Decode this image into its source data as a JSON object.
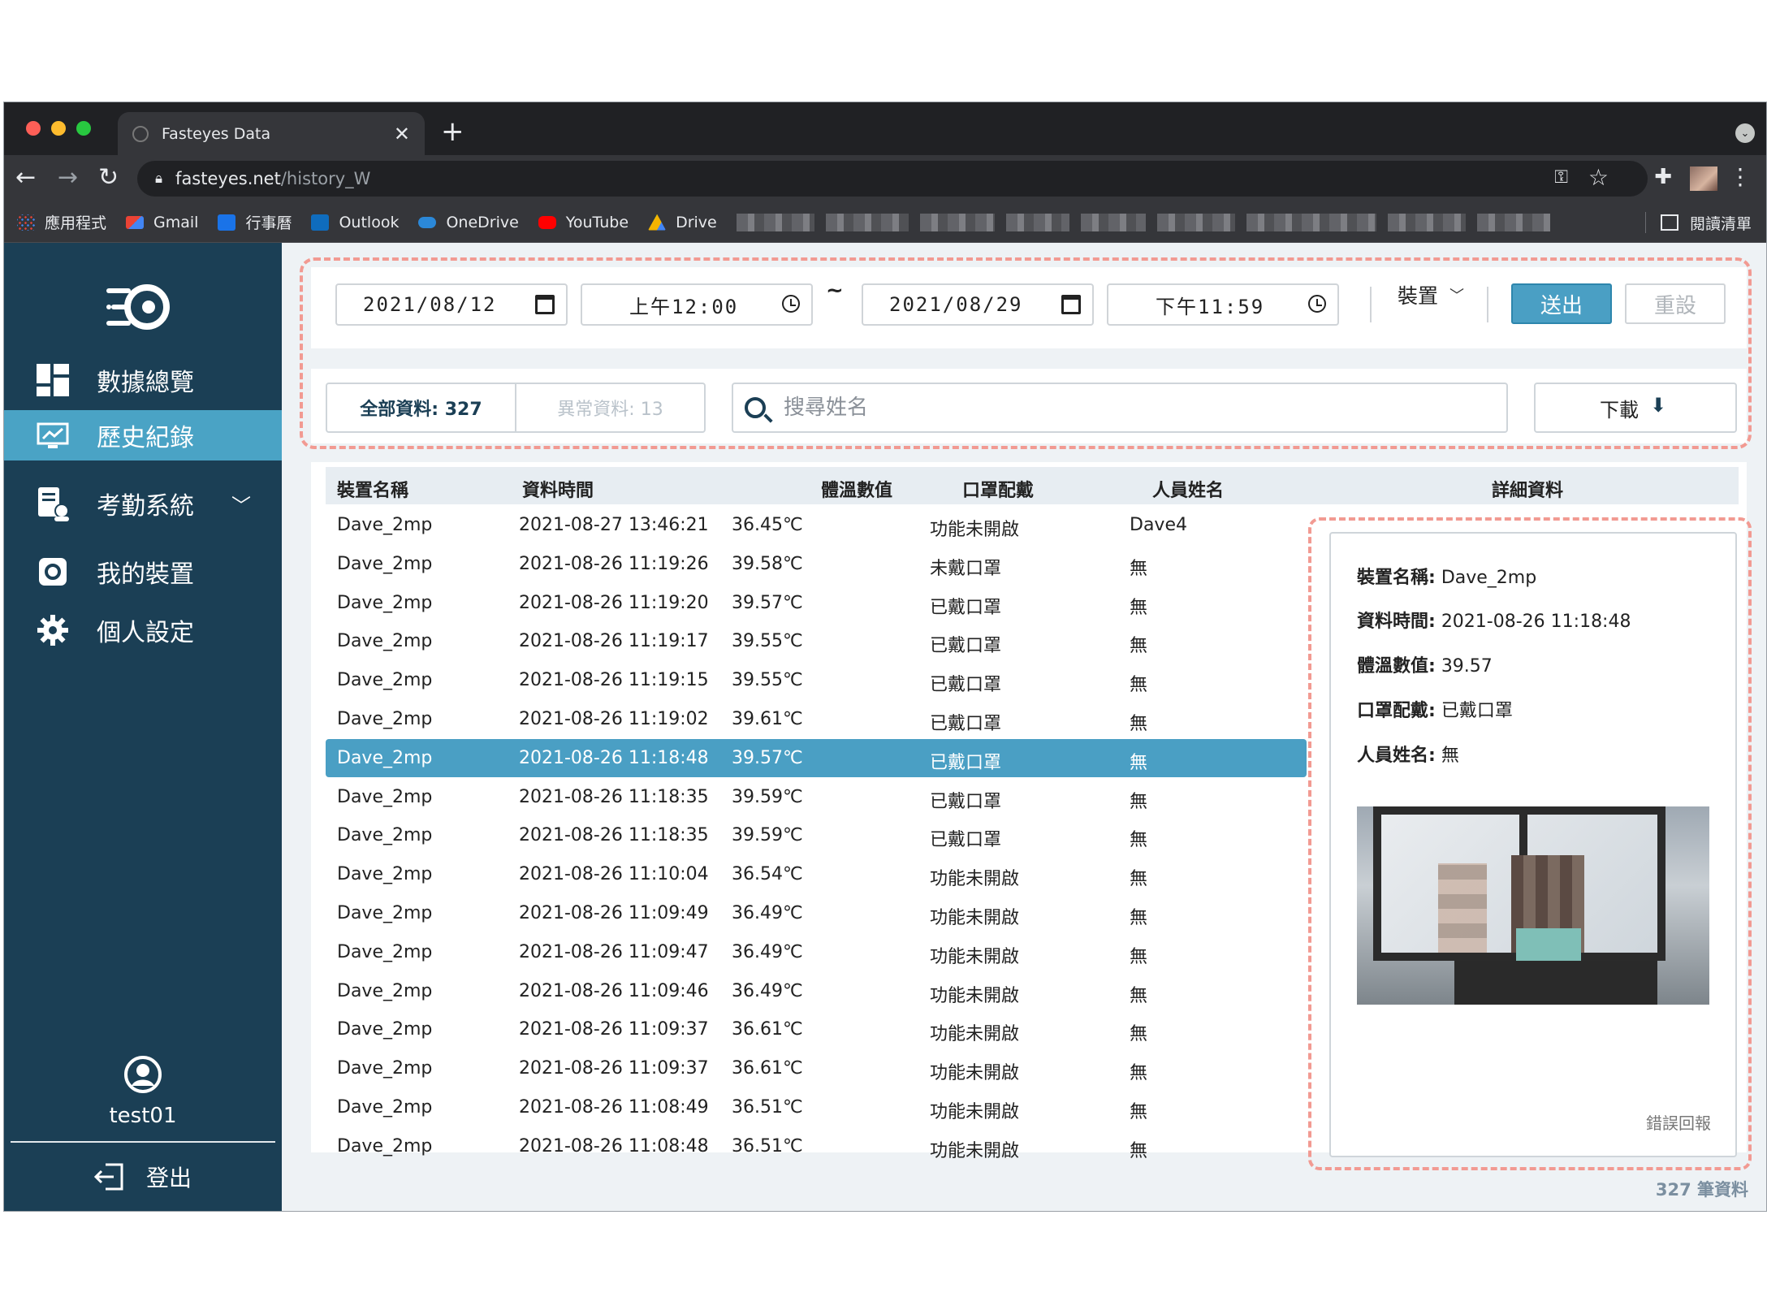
{
  "browser": {
    "tab_title": "Fasteyes Data",
    "tab_close": "✕",
    "new_tab": "+",
    "url_host": "fasteyes.net",
    "url_path": "/history_W",
    "bookmarks": [
      {
        "label": "應用程式",
        "icon": "apps-grid-icon"
      },
      {
        "label": "Gmail",
        "icon": "gmail-icon"
      },
      {
        "label": "行事曆",
        "icon": "calendar-icon"
      },
      {
        "label": "Outlook",
        "icon": "outlook-icon"
      },
      {
        "label": "OneDrive",
        "icon": "onedrive-icon"
      },
      {
        "label": "YouTube",
        "icon": "youtube-icon"
      },
      {
        "label": "Drive",
        "icon": "drive-icon"
      }
    ],
    "reading_list": "閱讀清單"
  },
  "sidebar": {
    "items": [
      {
        "label": "數據總覽",
        "icon": "dashboard-icon"
      },
      {
        "label": "歷史紀錄",
        "icon": "history-icon"
      },
      {
        "label": "考勤系統",
        "icon": "attendance-icon"
      },
      {
        "label": "我的裝置",
        "icon": "device-icon"
      },
      {
        "label": "個人設定",
        "icon": "gear-icon"
      }
    ],
    "user": "test01",
    "logout": "登出"
  },
  "filters": {
    "start_date": "2021/08/12",
    "start_time": "上午12:00",
    "separator": "~",
    "end_date": "2021/08/29",
    "end_time": "下午11:59",
    "device_label": "裝置",
    "submit": "送出",
    "reset": "重設"
  },
  "tabs": {
    "all": "全部資料: 327",
    "abnormal": "異常資料: 13"
  },
  "search": {
    "placeholder": "搜尋姓名",
    "value": ""
  },
  "download": "下載",
  "table": {
    "headers": [
      "裝置名稱",
      "資料時間",
      "體溫數值",
      "口罩配戴",
      "人員姓名",
      "詳細資料"
    ],
    "selected_index": 6,
    "rows": [
      [
        "Dave_2mp",
        "2021-08-27 13:46:21",
        "36.45℃",
        "功能未開啟",
        "Dave4"
      ],
      [
        "Dave_2mp",
        "2021-08-26 11:19:26",
        "39.58℃",
        "未戴口罩",
        "無"
      ],
      [
        "Dave_2mp",
        "2021-08-26 11:19:20",
        "39.57℃",
        "已戴口罩",
        "無"
      ],
      [
        "Dave_2mp",
        "2021-08-26 11:19:17",
        "39.55℃",
        "已戴口罩",
        "無"
      ],
      [
        "Dave_2mp",
        "2021-08-26 11:19:15",
        "39.55℃",
        "已戴口罩",
        "無"
      ],
      [
        "Dave_2mp",
        "2021-08-26 11:19:02",
        "39.61℃",
        "已戴口罩",
        "無"
      ],
      [
        "Dave_2mp",
        "2021-08-26 11:18:48",
        "39.57℃",
        "已戴口罩",
        "無"
      ],
      [
        "Dave_2mp",
        "2021-08-26 11:18:35",
        "39.59℃",
        "已戴口罩",
        "無"
      ],
      [
        "Dave_2mp",
        "2021-08-26 11:18:35",
        "39.59℃",
        "已戴口罩",
        "無"
      ],
      [
        "Dave_2mp",
        "2021-08-26 11:10:04",
        "36.54℃",
        "功能未開啟",
        "無"
      ],
      [
        "Dave_2mp",
        "2021-08-26 11:09:49",
        "36.49℃",
        "功能未開啟",
        "無"
      ],
      [
        "Dave_2mp",
        "2021-08-26 11:09:47",
        "36.49℃",
        "功能未開啟",
        "無"
      ],
      [
        "Dave_2mp",
        "2021-08-26 11:09:46",
        "36.49℃",
        "功能未開啟",
        "無"
      ],
      [
        "Dave_2mp",
        "2021-08-26 11:09:37",
        "36.61℃",
        "功能未開啟",
        "無"
      ],
      [
        "Dave_2mp",
        "2021-08-26 11:09:37",
        "36.61℃",
        "功能未開啟",
        "無"
      ],
      [
        "Dave_2mp",
        "2021-08-26 11:08:49",
        "36.51℃",
        "功能未開啟",
        "無"
      ],
      [
        "Dave_2mp",
        "2021-08-26 11:08:48",
        "36.51℃",
        "功能未開啟",
        "無"
      ]
    ]
  },
  "detail": {
    "device_label": "裝置名稱:",
    "device_value": "Dave_2mp",
    "time_label": "資料時間:",
    "time_value": "2021-08-26 11:18:48",
    "temp_label": "體溫數值:",
    "temp_value": "39.57",
    "mask_label": "口罩配戴:",
    "mask_value": "已戴口罩",
    "name_label": "人員姓名:",
    "name_value": "無",
    "error_report": "錯誤回報"
  },
  "record_count": "327 筆資料",
  "colors": {
    "sidebar": "#1b3f55",
    "accent": "#4a9fc4",
    "highlight_dash": "#f29a92"
  }
}
